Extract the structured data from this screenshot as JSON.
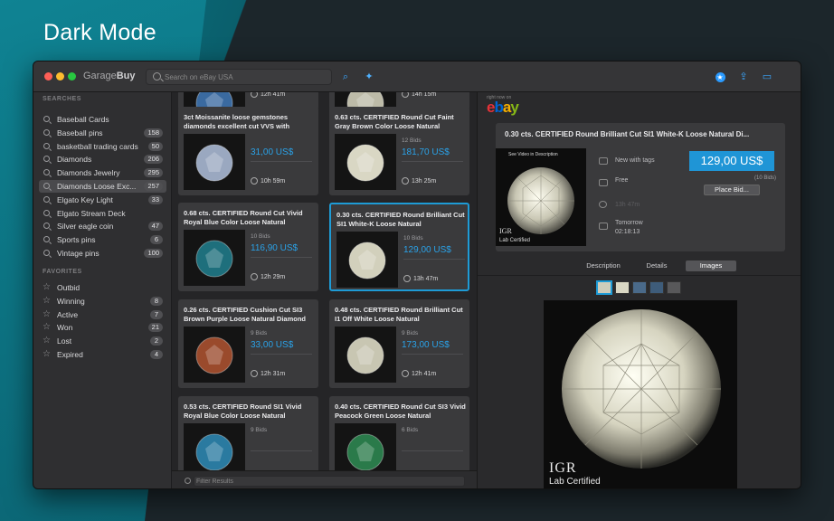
{
  "hero_title": "Dark Mode",
  "app": {
    "name_light": "Garage",
    "name_bold": "Buy",
    "search_placeholder": "Search on eBay USA"
  },
  "colors": {
    "accent": "#1f95d6",
    "price": "#2aa2e8"
  },
  "sidebar": {
    "searches_header": "SEARCHES",
    "searches": [
      {
        "label": "Baseball Cards",
        "count": ""
      },
      {
        "label": "Baseball pins",
        "count": "158"
      },
      {
        "label": "basketball trading cards",
        "count": "50"
      },
      {
        "label": "Diamonds",
        "count": "206"
      },
      {
        "label": "Diamonds Jewelry",
        "count": "295"
      },
      {
        "label": "Diamonds Loose Exc...",
        "count": "257"
      },
      {
        "label": "Elgato Key Light",
        "count": "33"
      },
      {
        "label": "Elgato Stream Deck",
        "count": ""
      },
      {
        "label": "Silver eagle coin",
        "count": "47"
      },
      {
        "label": "Sports pins",
        "count": "6"
      },
      {
        "label": "Vintage pins",
        "count": "100"
      }
    ],
    "favorites_header": "FAVORITES",
    "favorites": [
      {
        "label": "Outbid",
        "count": ""
      },
      {
        "label": "Winning",
        "count": "8"
      },
      {
        "label": "Active",
        "count": "7"
      },
      {
        "label": "Won",
        "count": "21"
      },
      {
        "label": "Lost",
        "count": "2"
      },
      {
        "label": "Expired",
        "count": "4"
      }
    ]
  },
  "results": {
    "filter_placeholder": "Filter Results",
    "cards": [
      {
        "title": "",
        "bids": "",
        "price": "",
        "time": "12h 41m"
      },
      {
        "title": "",
        "bids": "",
        "price": "",
        "time": "14h 15m"
      },
      {
        "title": "3ct Moissanite loose gemstones diamonds excellent cut VVS with",
        "bids": "",
        "price": "31,00 US$",
        "time": "10h 59m"
      },
      {
        "title": "0.63 cts. CERTIFIED Round Cut Faint Gray Brown Color Loose Natural",
        "bids": "12 Bids",
        "price": "181,70 US$",
        "time": "13h 25m"
      },
      {
        "title": "0.68 cts. CERTIFIED Round Cut Vivid Royal Blue Color Loose Natural",
        "bids": "10 Bids",
        "price": "116,90 US$",
        "time": "12h 29m"
      },
      {
        "title": "0.30 cts. CERTIFIED Round Brilliant Cut SI1 White-K Loose Natural",
        "bids": "10 Bids",
        "price": "129,00 US$",
        "time": "13h 47m"
      },
      {
        "title": "0.26 cts. CERTIFIED Cushion Cut SI3 Brown Purple Loose Natural Diamond",
        "bids": "9 Bids",
        "price": "33,00 US$",
        "time": "12h 31m"
      },
      {
        "title": "0.48 cts. CERTIFIED Round Brilliant Cut I1 Off White Loose Natural",
        "bids": "9 Bids",
        "price": "173,00 US$",
        "time": "12h 41m"
      },
      {
        "title": "0.53 cts. CERTIFIED Round SI1 Vivid Royal Blue Color Loose Natural",
        "bids": "9 Bids",
        "price": "",
        "time": ""
      },
      {
        "title": "0.40 cts. CERTIFIED Round Cut SI3 Vivid Peacock Green Loose Natural",
        "bids": "6 Bids",
        "price": "",
        "time": ""
      }
    ]
  },
  "detail": {
    "right_now": "right now on",
    "ebay": {
      "e": "e",
      "b": "b",
      "a": "a",
      "y": "y"
    },
    "title": "0.30 cts. CERTIFIED Round Brilliant Cut SI1 White-K Loose Natural Di...",
    "image_caption_top": "See Video in Description",
    "condition": "New with tags",
    "shipping": "Free",
    "time_left": "13h 47m",
    "end_date": "Tomorrow",
    "end_time": "02:18:13",
    "price": "129,00 US$",
    "bids": "(10 Bids)",
    "place_bid": "Place Bid...",
    "tabs": [
      "Description",
      "Details",
      "Images"
    ],
    "igr_logo": "IGR",
    "igr_caption": "Lab Certified"
  }
}
